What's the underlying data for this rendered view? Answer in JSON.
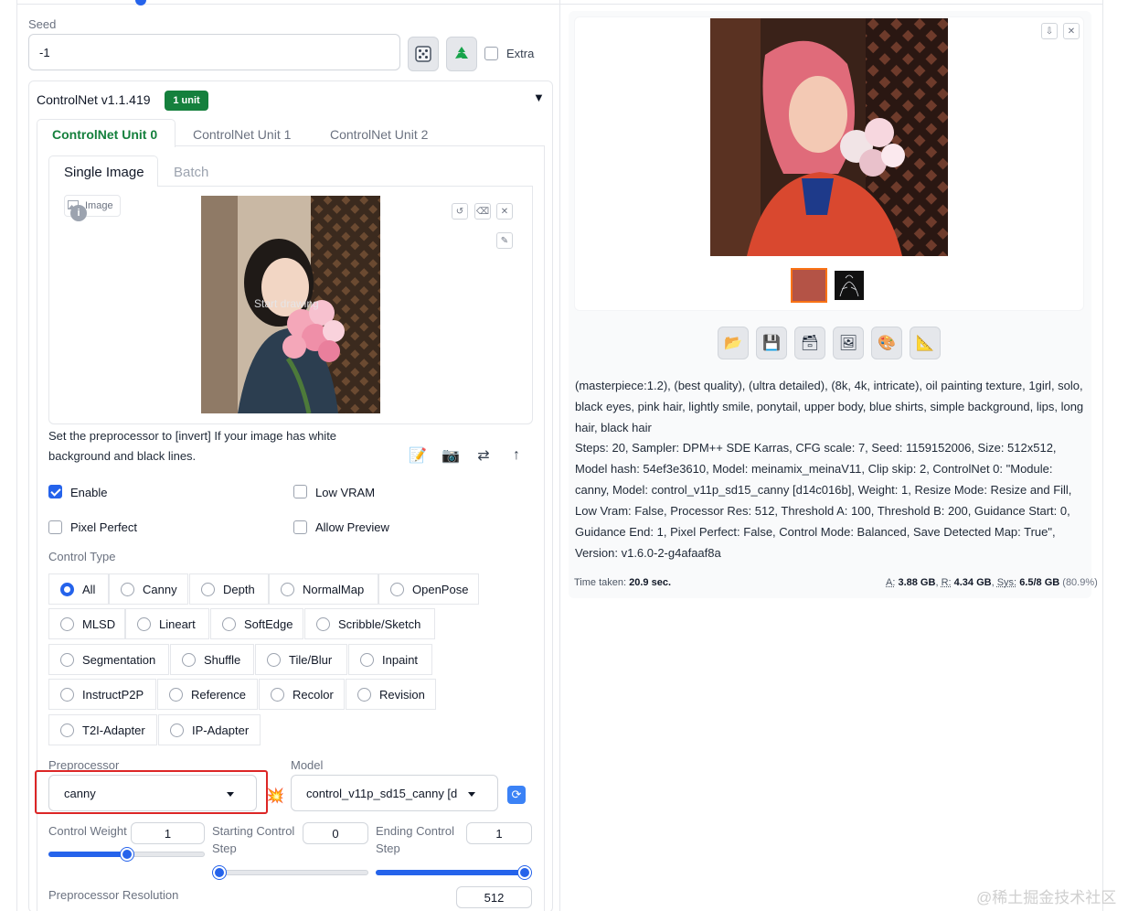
{
  "seed": {
    "label": "Seed",
    "value": "-1",
    "extra_label": "Extra"
  },
  "controlnet": {
    "title": "ControlNet v1.1.419",
    "badge": "1 unit",
    "collapse_glyph": "▼",
    "unit_tabs": [
      "ControlNet Unit 0",
      "ControlNet Unit 1",
      "ControlNet Unit 2"
    ],
    "image_tabs": [
      "Single Image",
      "Batch"
    ],
    "image_label": "Image",
    "canvas_hint": "Start drawing",
    "invert_hint": "Set the preprocessor to [invert] If your image has white background and black lines.",
    "enable_label": "Enable",
    "low_vram_label": "Low VRAM",
    "pixel_perfect_label": "Pixel Perfect",
    "allow_preview_label": "Allow Preview",
    "control_type_label": "Control Type",
    "control_types": [
      "All",
      "Canny",
      "Depth",
      "NormalMap",
      "OpenPose",
      "MLSD",
      "Lineart",
      "SoftEdge",
      "Scribble/Sketch",
      "Segmentation",
      "Shuffle",
      "Tile/Blur",
      "Inpaint",
      "InstructP2P",
      "Reference",
      "Recolor",
      "Revision",
      "T2I-Adapter",
      "IP-Adapter"
    ],
    "selected_control_type": "All",
    "preprocessor_label": "Preprocessor",
    "preprocessor_value": "canny",
    "model_label": "Model",
    "model_value": "control_v11p_sd15_canny [d",
    "control_weight_label": "Control Weight",
    "control_weight_value": "1",
    "control_weight_fraction": 0.5,
    "starting_step_label": "Starting Control Step",
    "starting_step_value": "0",
    "ending_step_label": "Ending Control Step",
    "ending_step_value": "1",
    "preproc_resolution_label": "Preprocessor Resolution",
    "preproc_resolution_value": "512"
  },
  "output": {
    "prompt": "(masterpiece:1.2), (best quality), (ultra detailed), (8k, 4k, intricate), oil painting texture, 1girl, solo, black eyes, pink hair, lightly smile, ponytail, upper body, blue shirts, simple background, lips, long hair, black hair",
    "params": "Steps: 20, Sampler: DPM++ SDE Karras, CFG scale: 7, Seed: 1159152006, Size: 512x512, Model hash: 54ef3e3610, Model: meinamix_meinaV11, Clip skip: 2, ControlNet 0: \"Module: canny, Model: control_v11p_sd15_canny [d14c016b], Weight: 1, Resize Mode: Resize and Fill, Low Vram: False, Processor Res: 512, Threshold A: 100, Threshold B: 200, Guidance Start: 0, Guidance End: 1, Pixel Perfect: False, Control Mode: Balanced, Save Detected Map: True\", Version: v1.6.0-2-g4afaaf8a",
    "time_prefix": "Time taken:",
    "time_value": "20.9 sec.",
    "mem_a_label": "A:",
    "mem_a_value": "3.88 GB",
    "mem_r_label": "R:",
    "mem_r_value": "4.34 GB",
    "mem_sys_label": "Sys:",
    "mem_sys_value": "6.5/8 GB",
    "mem_pct": "(80.9%)"
  },
  "watermark": "@稀土掘金技术社区",
  "colors": {
    "accent": "#2563eb",
    "tab_active": "#15803d",
    "badge_bg": "#15803d",
    "highlight_box": "#dc2626"
  }
}
